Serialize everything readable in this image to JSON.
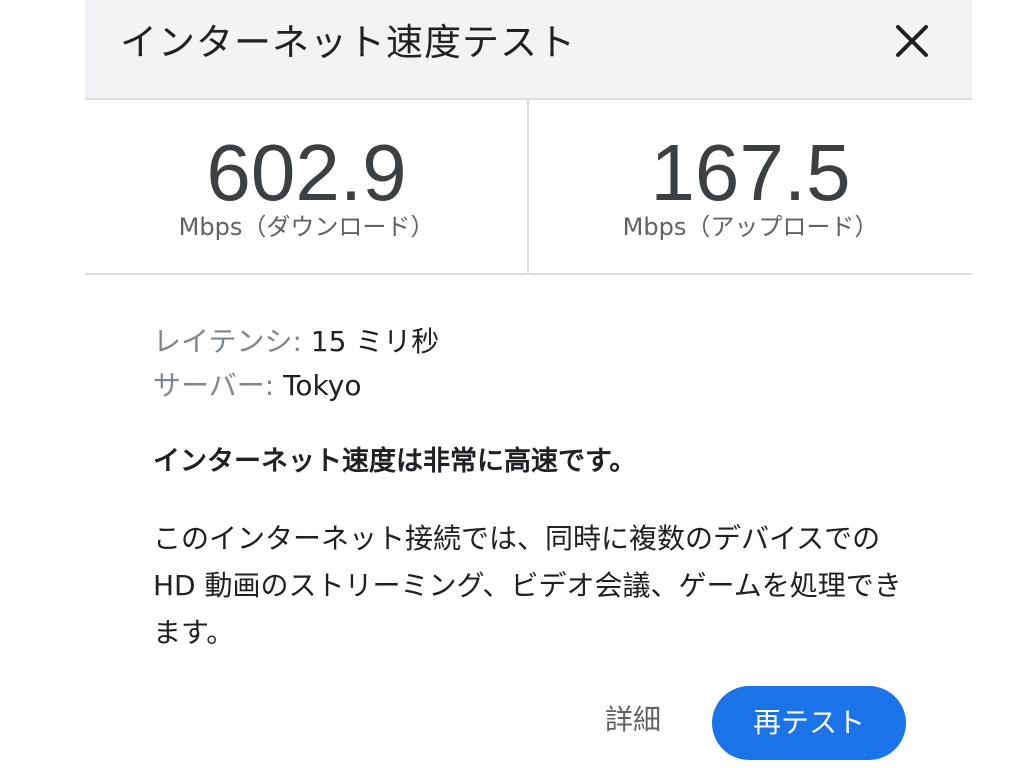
{
  "header": {
    "title": "インターネット速度テスト",
    "close_icon": "close-icon"
  },
  "results": {
    "download": {
      "value": "602.9",
      "unit": "Mbps（ダウンロード）"
    },
    "upload": {
      "value": "167.5",
      "unit": "Mbps（アップロード）"
    }
  },
  "details": {
    "latency_label": "レイテンシ:",
    "latency_value": "15 ミリ秒",
    "server_label": "サーバー:",
    "server_value": "Tokyo"
  },
  "summary": "インターネット速度は非常に高速です。",
  "description": "このインターネット接続では、同時に複数のデバイスでの HD 動画のストリーミング、ビデオ会議、ゲームを処理できます。",
  "actions": {
    "details_label": "詳細",
    "retest_label": "再テスト"
  },
  "colors": {
    "accent": "#1a73e8",
    "header_bg": "#f1f3f4",
    "divider": "#dadce0"
  }
}
